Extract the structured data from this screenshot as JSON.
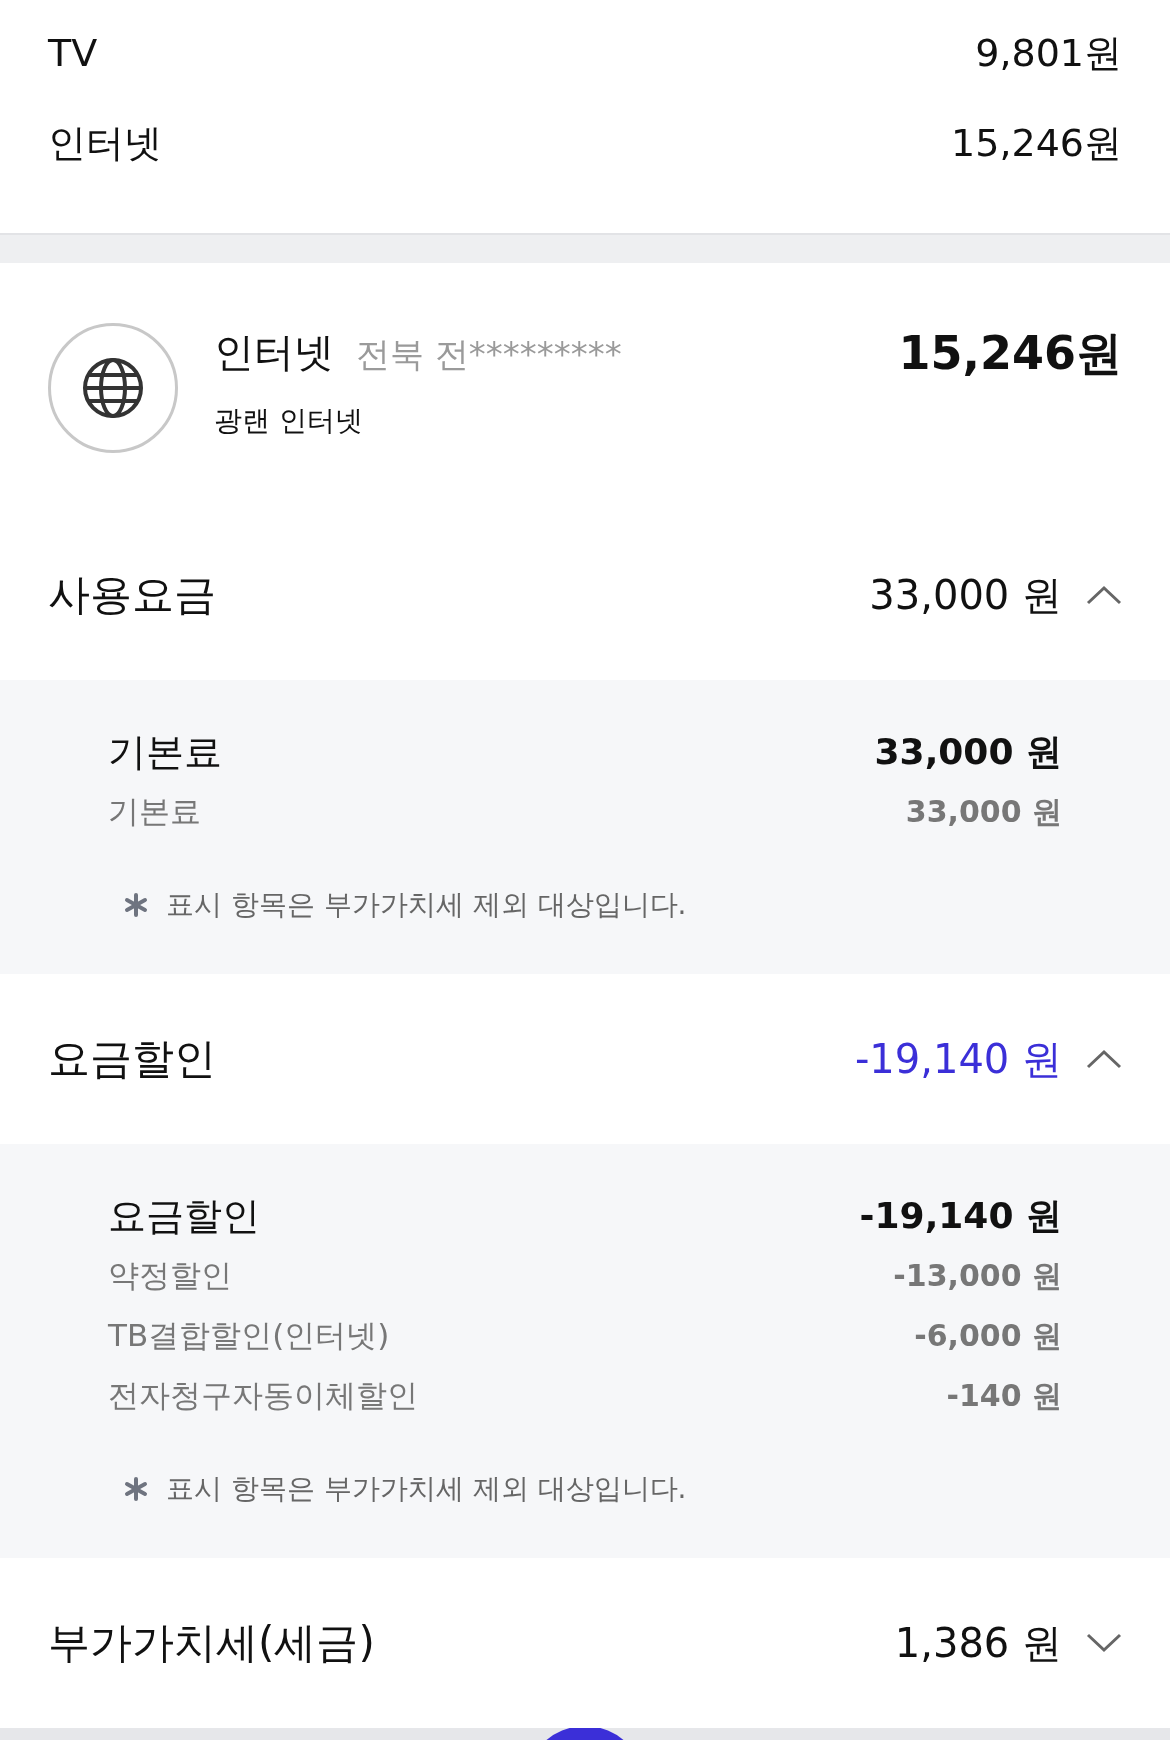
{
  "summary": [
    {
      "label": "TV",
      "amount": "9,801원"
    },
    {
      "label": "인터넷",
      "amount": "15,246원"
    }
  ],
  "service": {
    "name": "인터넷",
    "location": "전북 전*********",
    "plan": "광랜 인터넷",
    "amount": "15,246원"
  },
  "sections": [
    {
      "title": "사용요금",
      "amount": "33,000 원",
      "kind": "charge",
      "expanded": true,
      "detail": {
        "title": "기본료",
        "amount": "33,000 원",
        "items": [
          {
            "label": "기본료",
            "amount": "33,000 원"
          }
        ],
        "note": "표시 항목은 부가가치세 제외 대상입니다."
      }
    },
    {
      "title": "요금할인",
      "amount": "-19,140 원",
      "kind": "discount",
      "expanded": true,
      "detail": {
        "title": "요금할인",
        "amount": "-19,140 원",
        "items": [
          {
            "label": "약정할인",
            "amount": "-13,000 원"
          },
          {
            "label": "TB결합할인(인터넷)",
            "amount": "-6,000 원"
          },
          {
            "label": "전자청구자동이체할인",
            "amount": "-140 원"
          }
        ],
        "note": "표시 항목은 부가가치세 제외 대상입니다."
      }
    },
    {
      "title": "부가가치세(세금)",
      "amount": "1,386 원",
      "kind": "charge",
      "expanded": false
    }
  ]
}
